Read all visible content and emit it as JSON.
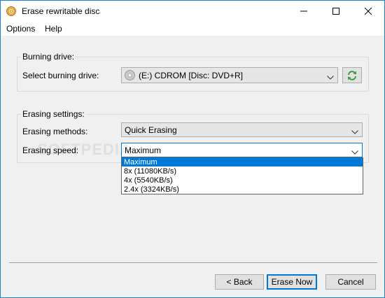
{
  "window": {
    "title": "Erase rewritable disc",
    "controls": {
      "minimize": "minimize",
      "maximize": "maximize",
      "close": "close"
    }
  },
  "menu": {
    "items": [
      "Options",
      "Help"
    ]
  },
  "burning_drive": {
    "group_title": "Burning drive:",
    "select_label": "Select burning drive:",
    "selected_drive": "(E:) CDROM [Disc: DVD+R]"
  },
  "erasing": {
    "group_title": "Erasing settings:",
    "methods_label": "Erasing methods:",
    "method_value": "Quick Erasing",
    "speed_label": "Erasing speed:",
    "speed_value": "Maximum",
    "speed_options": [
      "Maximum",
      "8x (11080KB/s)",
      "4x (5540KB/s)",
      "2.4x (3324KB/s)"
    ],
    "selected_index": 0
  },
  "footer": {
    "back_label": "< Back",
    "erase_label": "Erase Now",
    "cancel_label": "Cancel"
  },
  "watermark": "SOFTPEDIA",
  "colors": {
    "accent": "#0078d7",
    "border": "#1883d7",
    "refresh_green": "#3a9b3a"
  }
}
